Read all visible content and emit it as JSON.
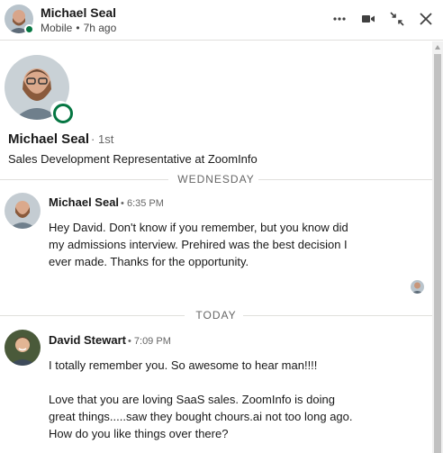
{
  "header": {
    "name": "Michael Seal",
    "status": "Mobile",
    "separator": "•",
    "last_active": "7h ago",
    "icons": [
      "more-icon",
      "video-call-icon",
      "minimize-icon",
      "close-icon"
    ]
  },
  "profile": {
    "name": "Michael Seal",
    "degree": "· 1st",
    "headline": "Sales Development Representative at ZoomInfo",
    "online": true
  },
  "dividers": {
    "first": "WEDNESDAY",
    "second": "TODAY"
  },
  "messages": [
    {
      "sender": "Michael Seal",
      "time": "• 6:35 PM",
      "body": "Hey David. Don't know if you remember, but you know did\nmy admissions interview. Prehired was the best decision I\never made. Thanks for the opportunity."
    },
    {
      "sender": "David Stewart",
      "time": "• 7:09 PM",
      "body": "I totally remember you. So awesome to hear man!!!!\n\nLove that you are loving SaaS sales. ZoomInfo is doing\ngreat things.....saw they bought chours.ai not too long ago.\nHow do you like things over there?"
    }
  ],
  "colors": {
    "presence": "#057642",
    "divider": "#e0dfdc",
    "muted_text": "#666666"
  }
}
